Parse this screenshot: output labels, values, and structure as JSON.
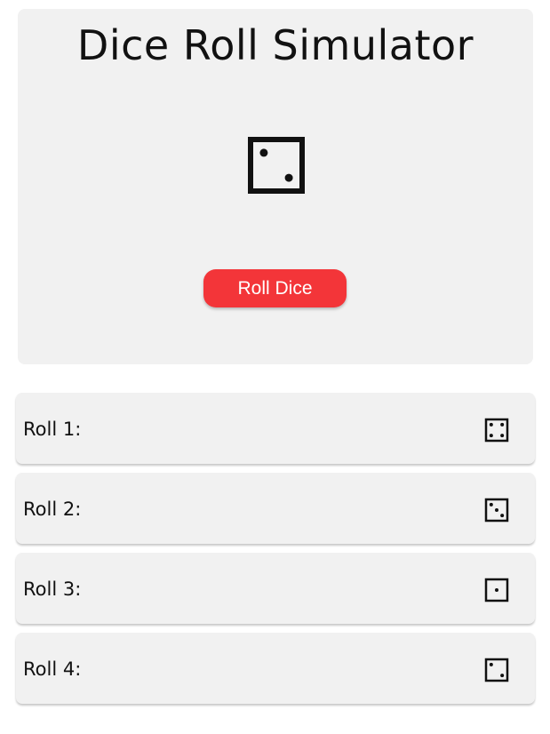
{
  "app": {
    "title": "Dice Roll Simulator"
  },
  "current_roll": {
    "value": 2,
    "icon": "die-face-2-icon"
  },
  "roll_button": {
    "label": "Roll Dice",
    "color": "#f33539"
  },
  "history": [
    {
      "label": "Roll 1:",
      "value": 4,
      "icon": "die-face-4-icon"
    },
    {
      "label": "Roll 2:",
      "value": 3,
      "icon": "die-face-3-icon"
    },
    {
      "label": "Roll 3:",
      "value": 1,
      "icon": "die-face-1-icon"
    },
    {
      "label": "Roll 4:",
      "value": 2,
      "icon": "die-face-2-icon"
    }
  ]
}
